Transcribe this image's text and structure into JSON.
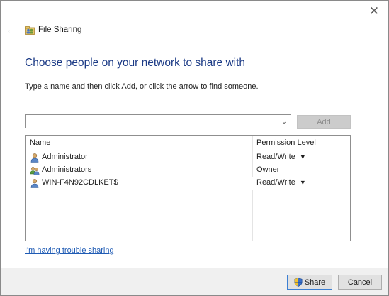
{
  "window": {
    "title": "File Sharing",
    "close_glyph": "✕",
    "back_glyph": "←"
  },
  "heading": "Choose people on your network to share with",
  "instruction": "Type a name and then click Add, or click the arrow to find someone.",
  "combo": {
    "value": "",
    "arrow_glyph": "⌄"
  },
  "add_button": {
    "label": "Add",
    "enabled": false
  },
  "list": {
    "columns": {
      "name": "Name",
      "permission": "Permission Level"
    },
    "rows": [
      {
        "name": "Administrator",
        "permission": "Read/Write",
        "has_dropdown": true,
        "icon": "user-icon",
        "selected": false
      },
      {
        "name": "Administrators",
        "permission": "Owner",
        "has_dropdown": false,
        "icon": "group-icon",
        "selected": false
      },
      {
        "name": "WIN-F4N92CDLKET$",
        "permission": "Read/Write",
        "has_dropdown": true,
        "icon": "user-icon",
        "selected": true
      }
    ]
  },
  "help_link": "I'm having trouble sharing",
  "footer": {
    "share_label": "Share",
    "cancel_label": "Cancel"
  },
  "colors": {
    "heading": "#1c3b86",
    "link": "#1f5bb4",
    "footer_bg": "#f0f0f0",
    "share_focus": "#3c7fd3"
  }
}
